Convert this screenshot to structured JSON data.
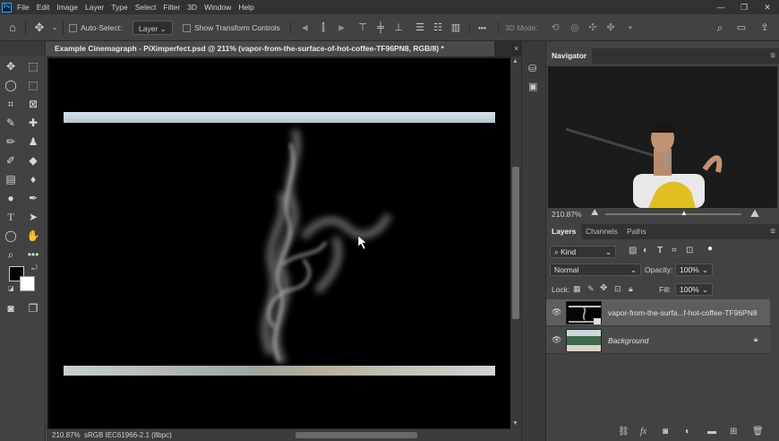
{
  "app": {
    "logo": "Ps",
    "menu": [
      "File",
      "Edit",
      "Image",
      "Layer",
      "Type",
      "Select",
      "Filter",
      "3D",
      "Window",
      "Help"
    ],
    "window_controls": [
      "—",
      "❐",
      "✕"
    ]
  },
  "options_bar": {
    "auto_select_label": "Auto-Select:",
    "auto_select_target": "Layer",
    "show_transform_label": "Show Transform Controls",
    "mode_3d_label": "3D Mode:",
    "more": "•••"
  },
  "document": {
    "tab_title": "Example Cinemagraph - PiXimperfect.psd @ 211% (vapor-from-the-surface-of-hot-coffee-TF96PN8, RGB/8) *",
    "close": "×",
    "zoom": "210.87%",
    "color_profile": "sRGB IEC61966-2.1 (8bpc)"
  },
  "navigator": {
    "title": "Navigator",
    "zoom": "210.87%"
  },
  "layers_panel": {
    "tabs": [
      "Layers",
      "Channels",
      "Paths"
    ],
    "filter_kind": "Kind",
    "blend_mode": "Normal",
    "opacity_label": "Opacity:",
    "opacity_value": "100%",
    "lock_label": "Lock:",
    "fill_label": "Fill:",
    "fill_value": "100%",
    "layers": [
      {
        "name": "vapor-from-the-surfa...f-hot-coffee-TF96PN8",
        "selected": true,
        "visible": true
      },
      {
        "name": "Background",
        "selected": false,
        "visible": true,
        "locked": true
      }
    ],
    "bottom_fx": "fx"
  },
  "icons": {
    "home": "home-icon",
    "move": "move-icon",
    "search": "search-icon",
    "eye": "eye-icon",
    "lock": "lock-icon"
  },
  "colors": {
    "accent": "#31a8ff",
    "panel_bg": "#424242",
    "menubar_bg": "#323232"
  }
}
